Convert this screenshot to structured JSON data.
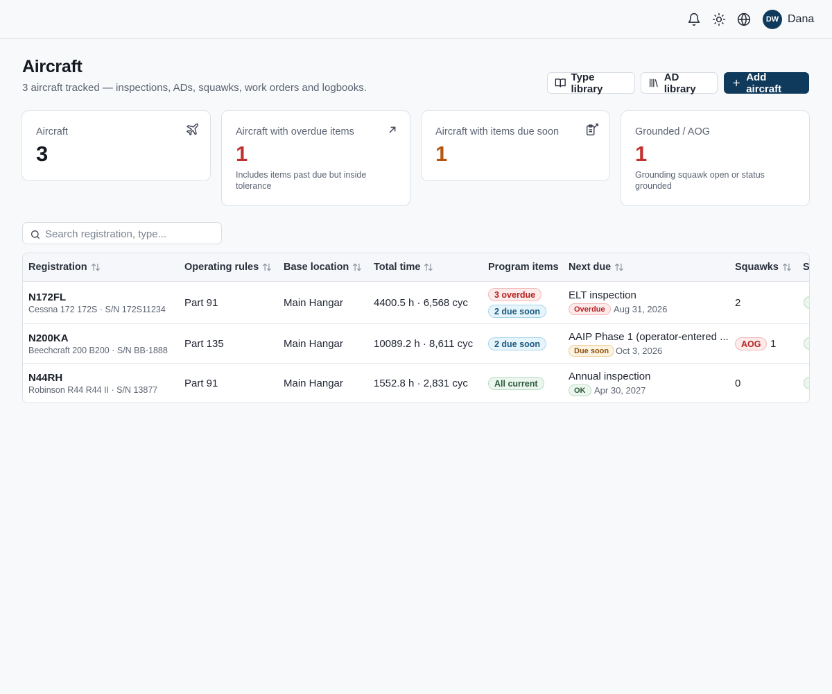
{
  "topbar": {
    "icons": [
      "bell-icon",
      "sun-icon",
      "globe-icon"
    ],
    "avatar_initials": "DW",
    "username": "Dana"
  },
  "header": {
    "title": "Aircraft",
    "subtitle": "3 aircraft tracked — inspections, ADs, squawks, work orders and logbooks.",
    "buttons": {
      "type_library": "Type library",
      "ad_library": "AD library",
      "add_aircraft": "Add aircraft"
    }
  },
  "stats": [
    {
      "label": "Aircraft",
      "value": "3",
      "note": "",
      "icon": "plane-icon",
      "color": "#141820"
    },
    {
      "label": "Aircraft with overdue items",
      "value": "1",
      "note": "Includes items past due but inside tolerance",
      "icon": "arrow-up-right-icon",
      "color": "#c0312f"
    },
    {
      "label": "Aircraft with items due soon",
      "value": "1",
      "note": "",
      "icon": "clipboard-icon",
      "color": "#b4560f"
    },
    {
      "label": "Grounded / AOG",
      "value": "1",
      "note": "Grounding squawk open or status grounded",
      "icon": "",
      "color": "#c0312f"
    }
  ],
  "search": {
    "placeholder": "Search registration, type..."
  },
  "table": {
    "columns": [
      "Registration",
      "Operating rules",
      "Base location",
      "Total time",
      "Program items",
      "Next due",
      "Squawks",
      "S"
    ],
    "rows": [
      {
        "registration": "N172FL",
        "model": "Cessna 172 172S · S/N 172S11234",
        "rules": "Part 91",
        "base": "Main Hangar",
        "total_time": "4400.5 h · 6,568 cyc",
        "program": [
          {
            "text": "3 overdue",
            "tone": "red"
          },
          {
            "text": "2 due soon",
            "tone": "blue"
          }
        ],
        "next_due_title": "ELT inspection",
        "next_due_status": "Overdue",
        "next_due_status_tone": "red",
        "next_due_date": "Aug 31, 2026",
        "squawk_badge": "",
        "squawks": "2"
      },
      {
        "registration": "N200KA",
        "model": "Beechcraft 200 B200 · S/N BB-1888",
        "rules": "Part 135",
        "base": "Main Hangar",
        "total_time": "10089.2 h · 8,611 cyc",
        "program": [
          {
            "text": "2 due soon",
            "tone": "blue"
          }
        ],
        "next_due_title": "AAIP Phase 1 (operator-entered ...",
        "next_due_status": "Due soon",
        "next_due_status_tone": "amber",
        "next_due_date": "Oct 3, 2026",
        "squawk_badge": "AOG",
        "squawks": "1"
      },
      {
        "registration": "N44RH",
        "model": "Robinson R44 R44 II · S/N 13877",
        "rules": "Part 91",
        "base": "Main Hangar",
        "total_time": "1552.8 h · 2,831 cyc",
        "program": [
          {
            "text": "All current",
            "tone": "green"
          }
        ],
        "next_due_title": "Annual inspection",
        "next_due_status": "OK",
        "next_due_status_tone": "green",
        "next_due_date": "Apr 30, 2027",
        "squawk_badge": "",
        "squawks": "0"
      }
    ]
  }
}
